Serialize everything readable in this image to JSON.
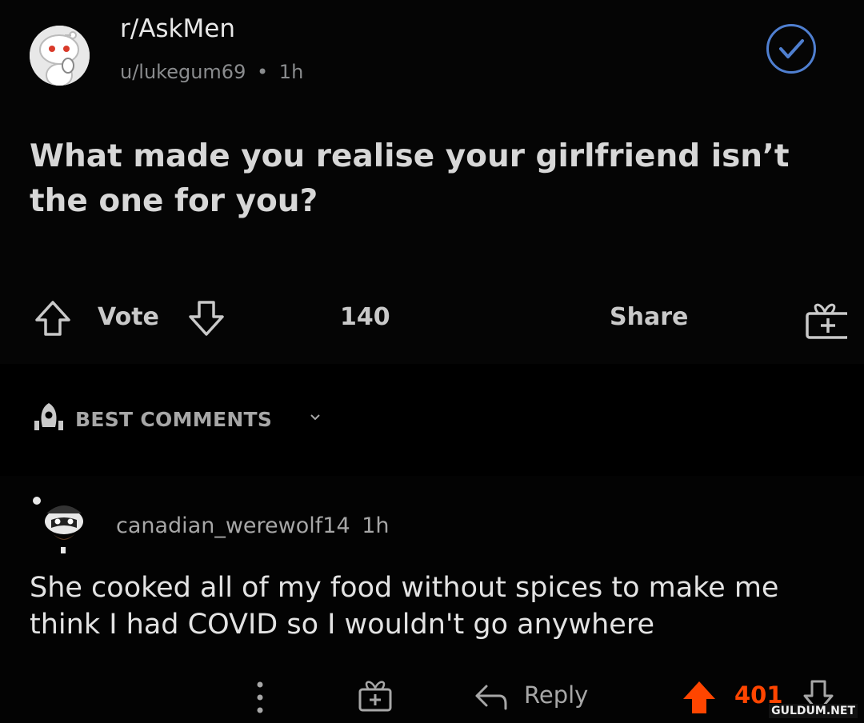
{
  "post": {
    "subreddit": "r/AskMen",
    "author": "u/lukegum69",
    "separator": "•",
    "time": "1h",
    "title": "What made you realise your girlfriend isn’t the one for you?",
    "vote_label": "Vote",
    "comment_count": "140",
    "share_label": "Share"
  },
  "comments_header": {
    "sort_label": "BEST COMMENTS"
  },
  "comment": {
    "username": "canadian_werewolf14",
    "time": "1h",
    "body": "She cooked all of my food without spices to make me think I had COVID so I wouldn't go anywhere",
    "reply_label": "Reply",
    "score": "401"
  },
  "watermark": "GULDUM.NET",
  "colors": {
    "upvote_active": "#ff4500",
    "verified_ring": "#4f7fd0",
    "background": "#030303"
  },
  "icons": [
    "snoo-avatar-icon",
    "verified-check-icon",
    "upvote-arrow-icon",
    "downvote-arrow-icon",
    "award-gift-icon",
    "rocket-sort-icon",
    "chevron-down-icon",
    "user-avatar-icon",
    "more-vertical-icon",
    "reply-arrow-icon"
  ]
}
